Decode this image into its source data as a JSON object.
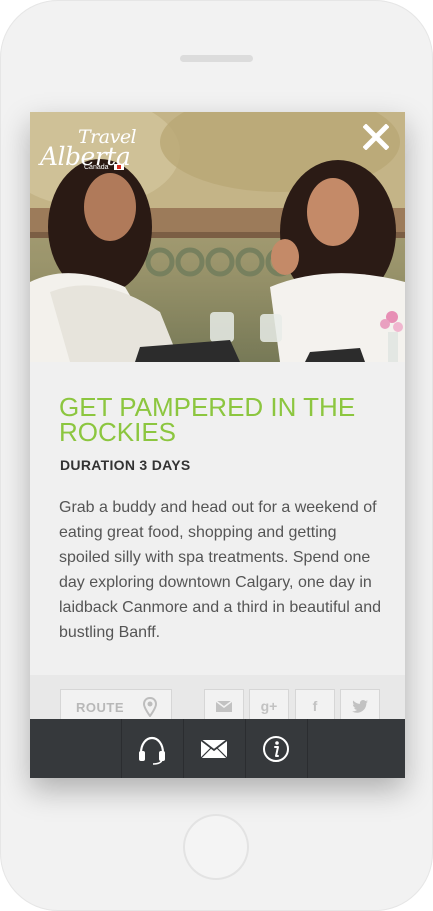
{
  "brand": {
    "logo_line1": "Travel",
    "logo_line2": "Alberta",
    "logo_country": "Canada"
  },
  "hero": {
    "image_icon": "photo-two-women-in-robes",
    "close_label": "✕"
  },
  "itinerary": {
    "title": "GET PAMPERED IN THE ROCKIES",
    "duration": "DURATION 3 DAYS",
    "description": "Grab a buddy and head out for a weekend of eating great food, shopping and getting spoiled silly with spa treatments. Spend one day exploring downtown Calgary, one day in laidback Canmore and a third in beautiful and bustling Banff."
  },
  "actions": {
    "route_label": "ROUTE",
    "route_icon": "map-pin-icon",
    "share_email_icon": "envelope-icon",
    "share_gplus_label": "g+",
    "share_facebook_label": "f",
    "share_twitter_icon": "twitter-icon"
  },
  "tabbar": {
    "items": [
      {
        "icon": "headset-icon"
      },
      {
        "icon": "envelope-icon"
      },
      {
        "icon": "info-icon"
      }
    ]
  },
  "colors": {
    "title_green": "#8cc63f",
    "tabbar": "#36393c",
    "text": "#555555"
  }
}
